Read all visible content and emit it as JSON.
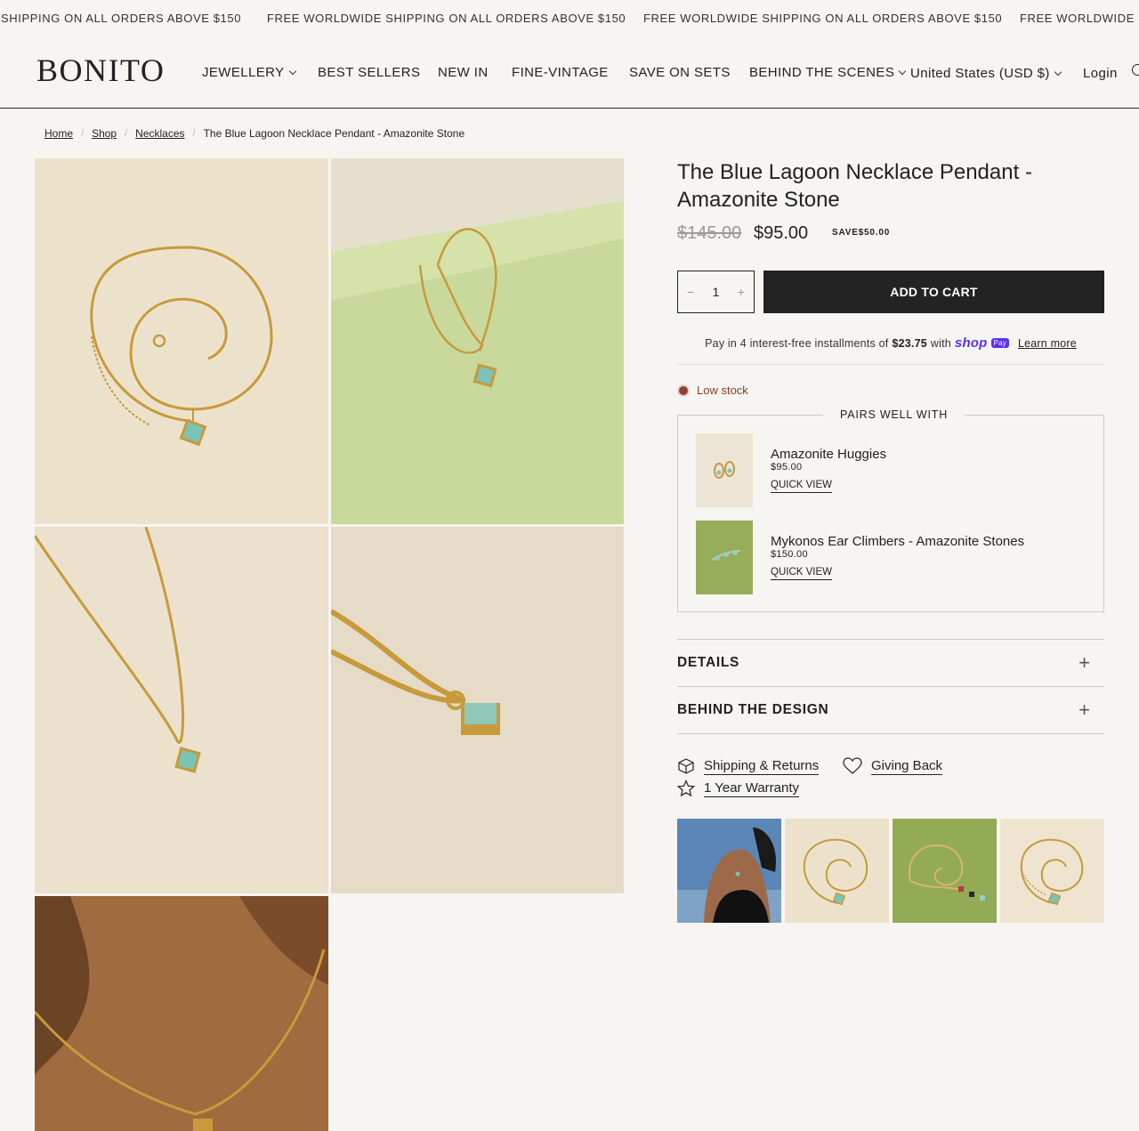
{
  "announcement": {
    "messages": [
      "SHIPPING ON ALL ORDERS ABOVE $150",
      "FREE WORLDWIDE SHIPPING ON ALL ORDERS ABOVE $150",
      "FREE WORLDWIDE SHIPPING ON ALL ORDERS ABOVE $150",
      "FREE WORLDWIDE S"
    ]
  },
  "header": {
    "logo": "BONITO",
    "nav": [
      "JEWELLERY",
      "BEST SELLERS",
      "NEW IN",
      "FINE-VINTAGE",
      "SAVE ON SETS",
      "BEHIND THE SCENES"
    ],
    "currency": "United States (USD $)",
    "login": "Login"
  },
  "breadcrumb": {
    "items": [
      "Home",
      "Shop",
      "Necklaces"
    ],
    "current": "The Blue Lagoon Necklace Pendant - Amazonite Stone"
  },
  "product": {
    "title": "The Blue Lagoon Necklace Pendant - Amazonite Stone",
    "price_compare": "$145.00",
    "price": "$95.00",
    "save": "SAVE$50.00",
    "quantity": "1",
    "qty_minus": "−",
    "qty_plus": "+",
    "add_to_cart": "ADD TO CART",
    "installments_prefix": "Pay in 4 interest-free installments of",
    "installments_amount": "$23.75",
    "installments_with": "with",
    "shop_logo": "shop",
    "shop_pay_badge": "Pay",
    "learn_more": "Learn more",
    "stock_status": "Low stock"
  },
  "pairs": {
    "title": "PAIRS WELL WITH",
    "items": [
      {
        "name": "Amazonite Huggies",
        "price": "$95.00",
        "action": "QUICK VIEW"
      },
      {
        "name": "Mykonos Ear Climbers - Amazonite Stones",
        "price": "$150.00",
        "action": "QUICK VIEW"
      }
    ]
  },
  "accordions": [
    "DETAILS",
    "BEHIND THE DESIGN"
  ],
  "accordion_icon": "+",
  "features": [
    {
      "label": "Shipping & Returns",
      "icon": "box-icon"
    },
    {
      "label": "Giving Back",
      "icon": "heart-icon"
    },
    {
      "label": "1 Year Warranty",
      "icon": "star-icon"
    }
  ],
  "colors": {
    "accent": "#232323",
    "shop_pay": "#5a31f4",
    "low_stock": "#8c4135"
  }
}
